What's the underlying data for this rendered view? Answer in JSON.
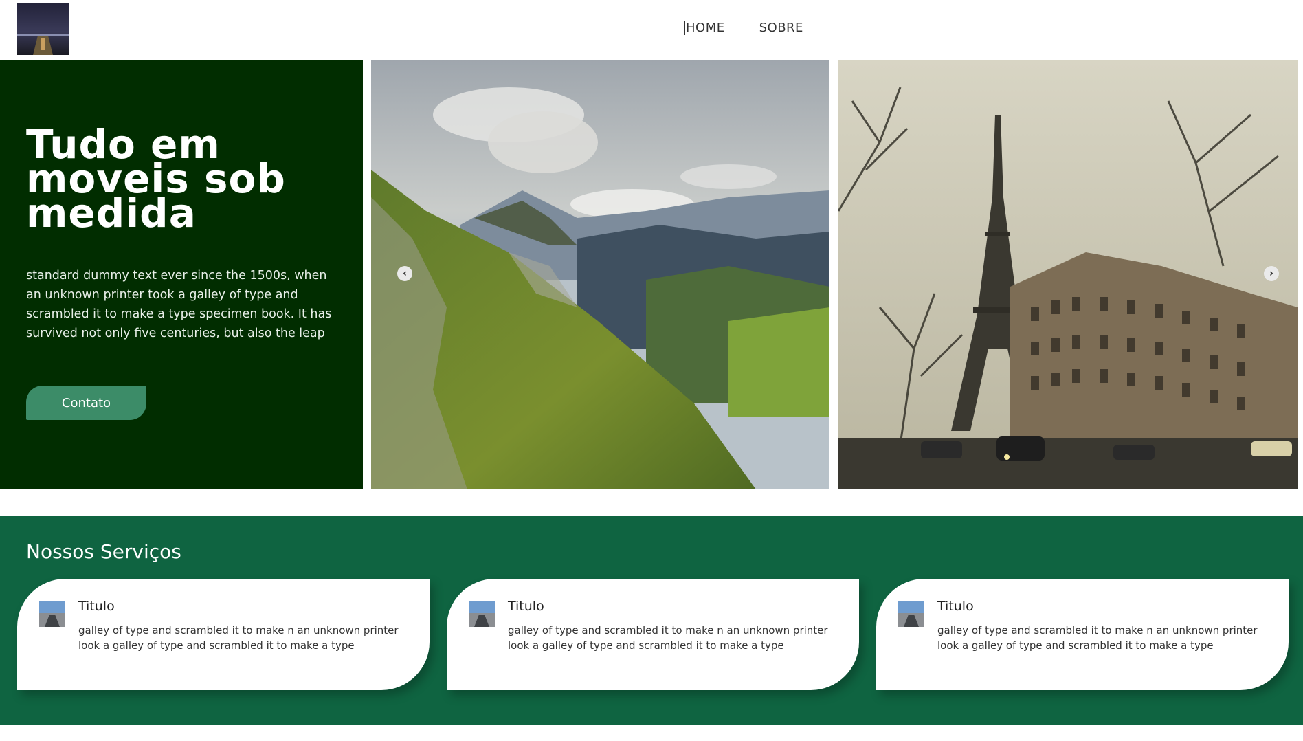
{
  "header": {
    "nav": [
      {
        "label": "HOME"
      },
      {
        "label": "SOBRE"
      }
    ]
  },
  "hero": {
    "title": "Tudo em moveis sob medida",
    "text": "standard dummy text ever since the 1500s, when an unknown printer took a galley of type and scrambled it to make a type specimen book. It has survived not only five centuries, but also the leap",
    "button_label": "Contato"
  },
  "carousel": {
    "prev_icon": "chevron-left-icon",
    "next_icon": "chevron-right-icon"
  },
  "services": {
    "heading": "Nossos Serviços",
    "cards": [
      {
        "title": "Titulo",
        "text": "galley of type and scrambled it to make n an unknown printer look a galley of type and scrambled it to make a type"
      },
      {
        "title": "Titulo",
        "text": "galley of type and scrambled it to make n an unknown printer look a galley of type and scrambled it to make a type"
      },
      {
        "title": "Titulo",
        "text": "galley of type and scrambled it to make n an unknown printer look a galley of type and scrambled it to make a type"
      }
    ]
  },
  "colors": {
    "hero_bg": "#012d00",
    "services_bg": "#0f6441",
    "button_bg": "#3c8c68"
  }
}
